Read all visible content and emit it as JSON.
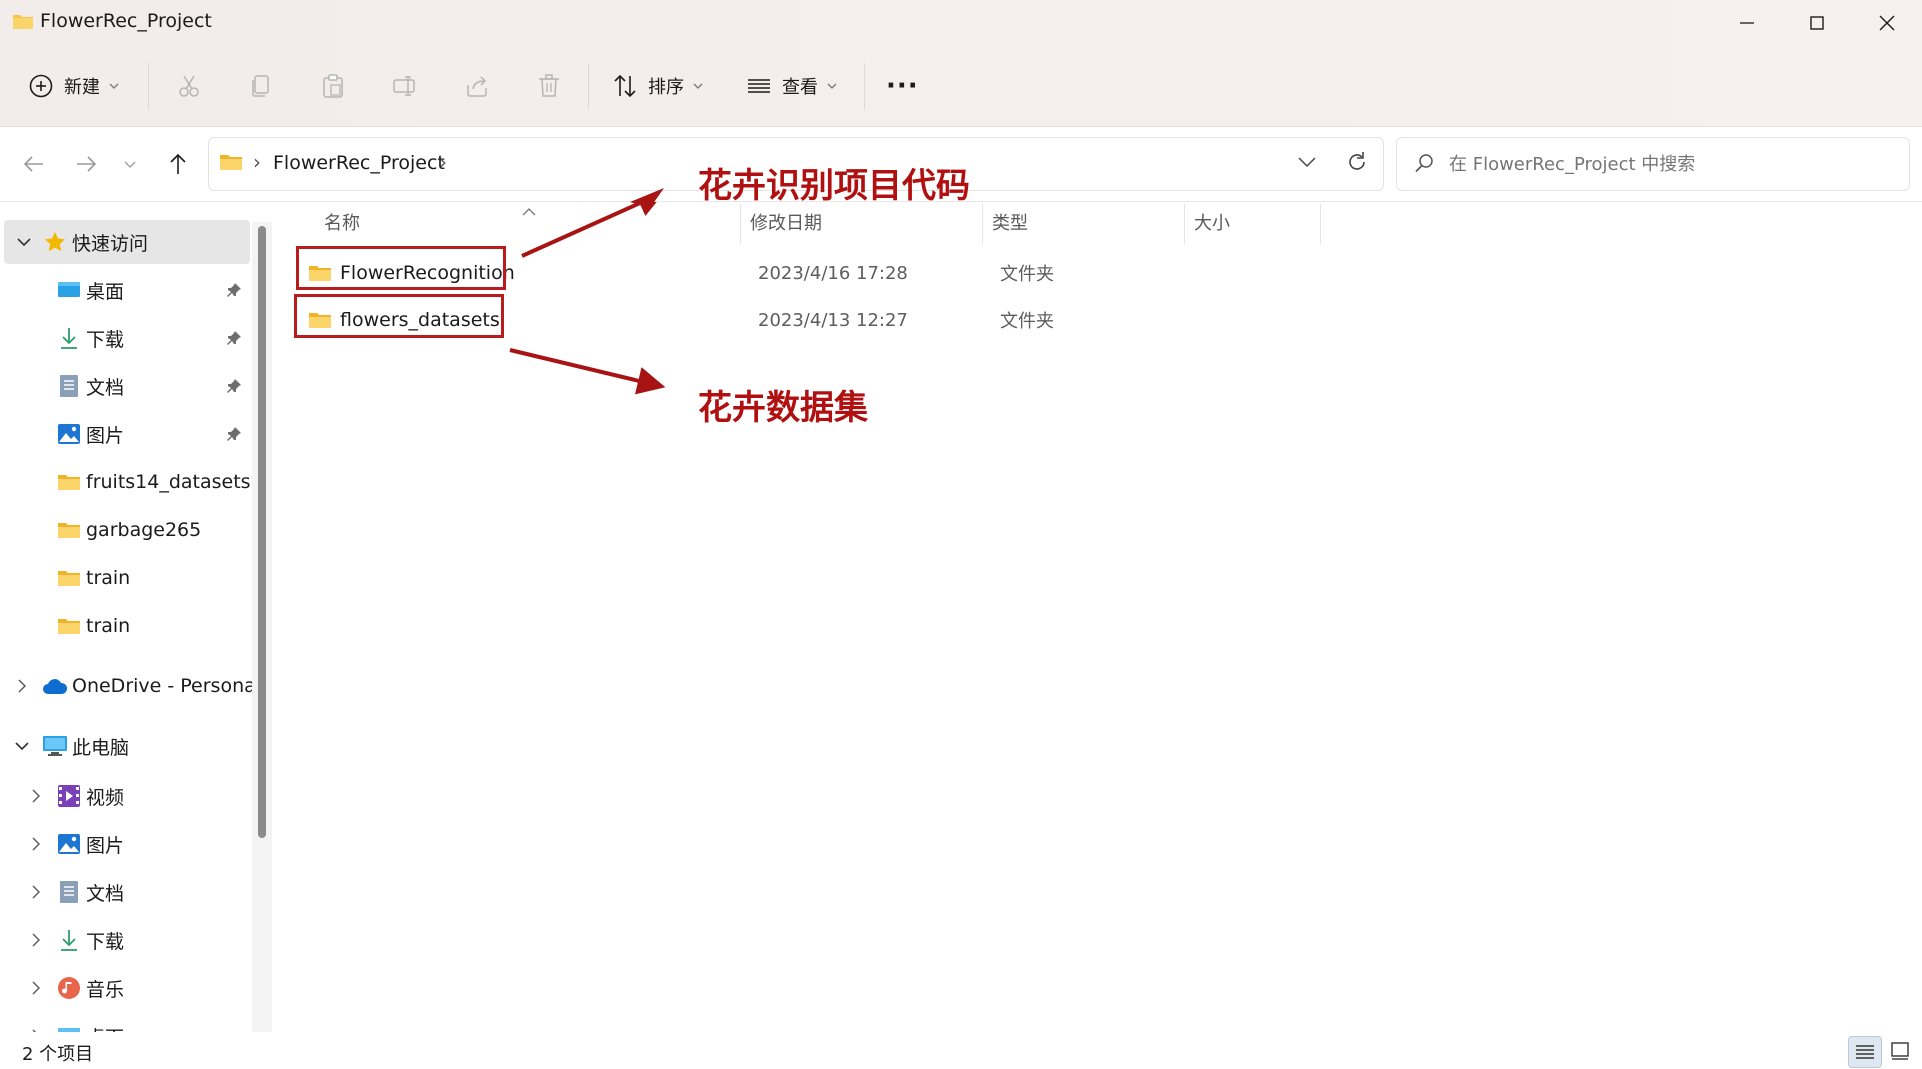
{
  "window": {
    "title": "FlowerRec_Project",
    "minimize_glyph": "—",
    "maximize_glyph": "☐",
    "close_glyph": "✕"
  },
  "toolbar": {
    "new_label": "新建",
    "sort_label": "排序",
    "view_label": "查看",
    "more_glyph": "···",
    "icons": [
      "plus-circle-icon",
      "cut-icon",
      "copy-icon",
      "paste-icon",
      "rename-icon",
      "share-icon",
      "delete-icon",
      "sort-icon",
      "view-icon",
      "more-icon"
    ]
  },
  "address": {
    "separator": "›",
    "breadcrumb": "FlowerRec_Project",
    "search_placeholder": "在 FlowerRec_Project 中搜索"
  },
  "sidebar": {
    "quick_access": "快速访问",
    "quick_items": [
      {
        "label": "桌面",
        "icon": "desktop-icon",
        "pinned": true
      },
      {
        "label": "下载",
        "icon": "download-icon",
        "pinned": true
      },
      {
        "label": "文档",
        "icon": "document-icon",
        "pinned": true
      },
      {
        "label": "图片",
        "icon": "picture-icon",
        "pinned": true
      },
      {
        "label": "fruits14_datasets",
        "icon": "folder-icon",
        "pinned": false
      },
      {
        "label": "garbage265",
        "icon": "folder-icon",
        "pinned": false
      },
      {
        "label": "train",
        "icon": "folder-icon",
        "pinned": false
      },
      {
        "label": "train",
        "icon": "folder-icon",
        "pinned": false
      }
    ],
    "onedrive": "OneDrive - Personal",
    "this_pc": "此电脑",
    "pc_items": [
      {
        "label": "视频",
        "icon": "video-icon"
      },
      {
        "label": "图片",
        "icon": "picture-icon"
      },
      {
        "label": "文档",
        "icon": "document-icon"
      },
      {
        "label": "下载",
        "icon": "download-icon"
      },
      {
        "label": "音乐",
        "icon": "music-icon"
      },
      {
        "label": "桌面",
        "icon": "desktop-icon"
      }
    ]
  },
  "columns": {
    "name": "名称",
    "modified": "修改日期",
    "type": "类型",
    "size": "大小"
  },
  "files": [
    {
      "name": "FlowerRecognition",
      "modified": "2023/4/16 17:28",
      "type": "文件夹",
      "size": ""
    },
    {
      "name": "flowers_datasets",
      "modified": "2023/4/13 12:27",
      "type": "文件夹",
      "size": ""
    }
  ],
  "annotations": {
    "code_label": "花卉识别项目代码",
    "dataset_label": "花卉数据集",
    "color": "#b01010"
  },
  "status": {
    "count_text": "2 个项目"
  },
  "colors": {
    "accent": "#0067c0",
    "folder": "#f8c54a",
    "highlight": "#b81c1c"
  }
}
